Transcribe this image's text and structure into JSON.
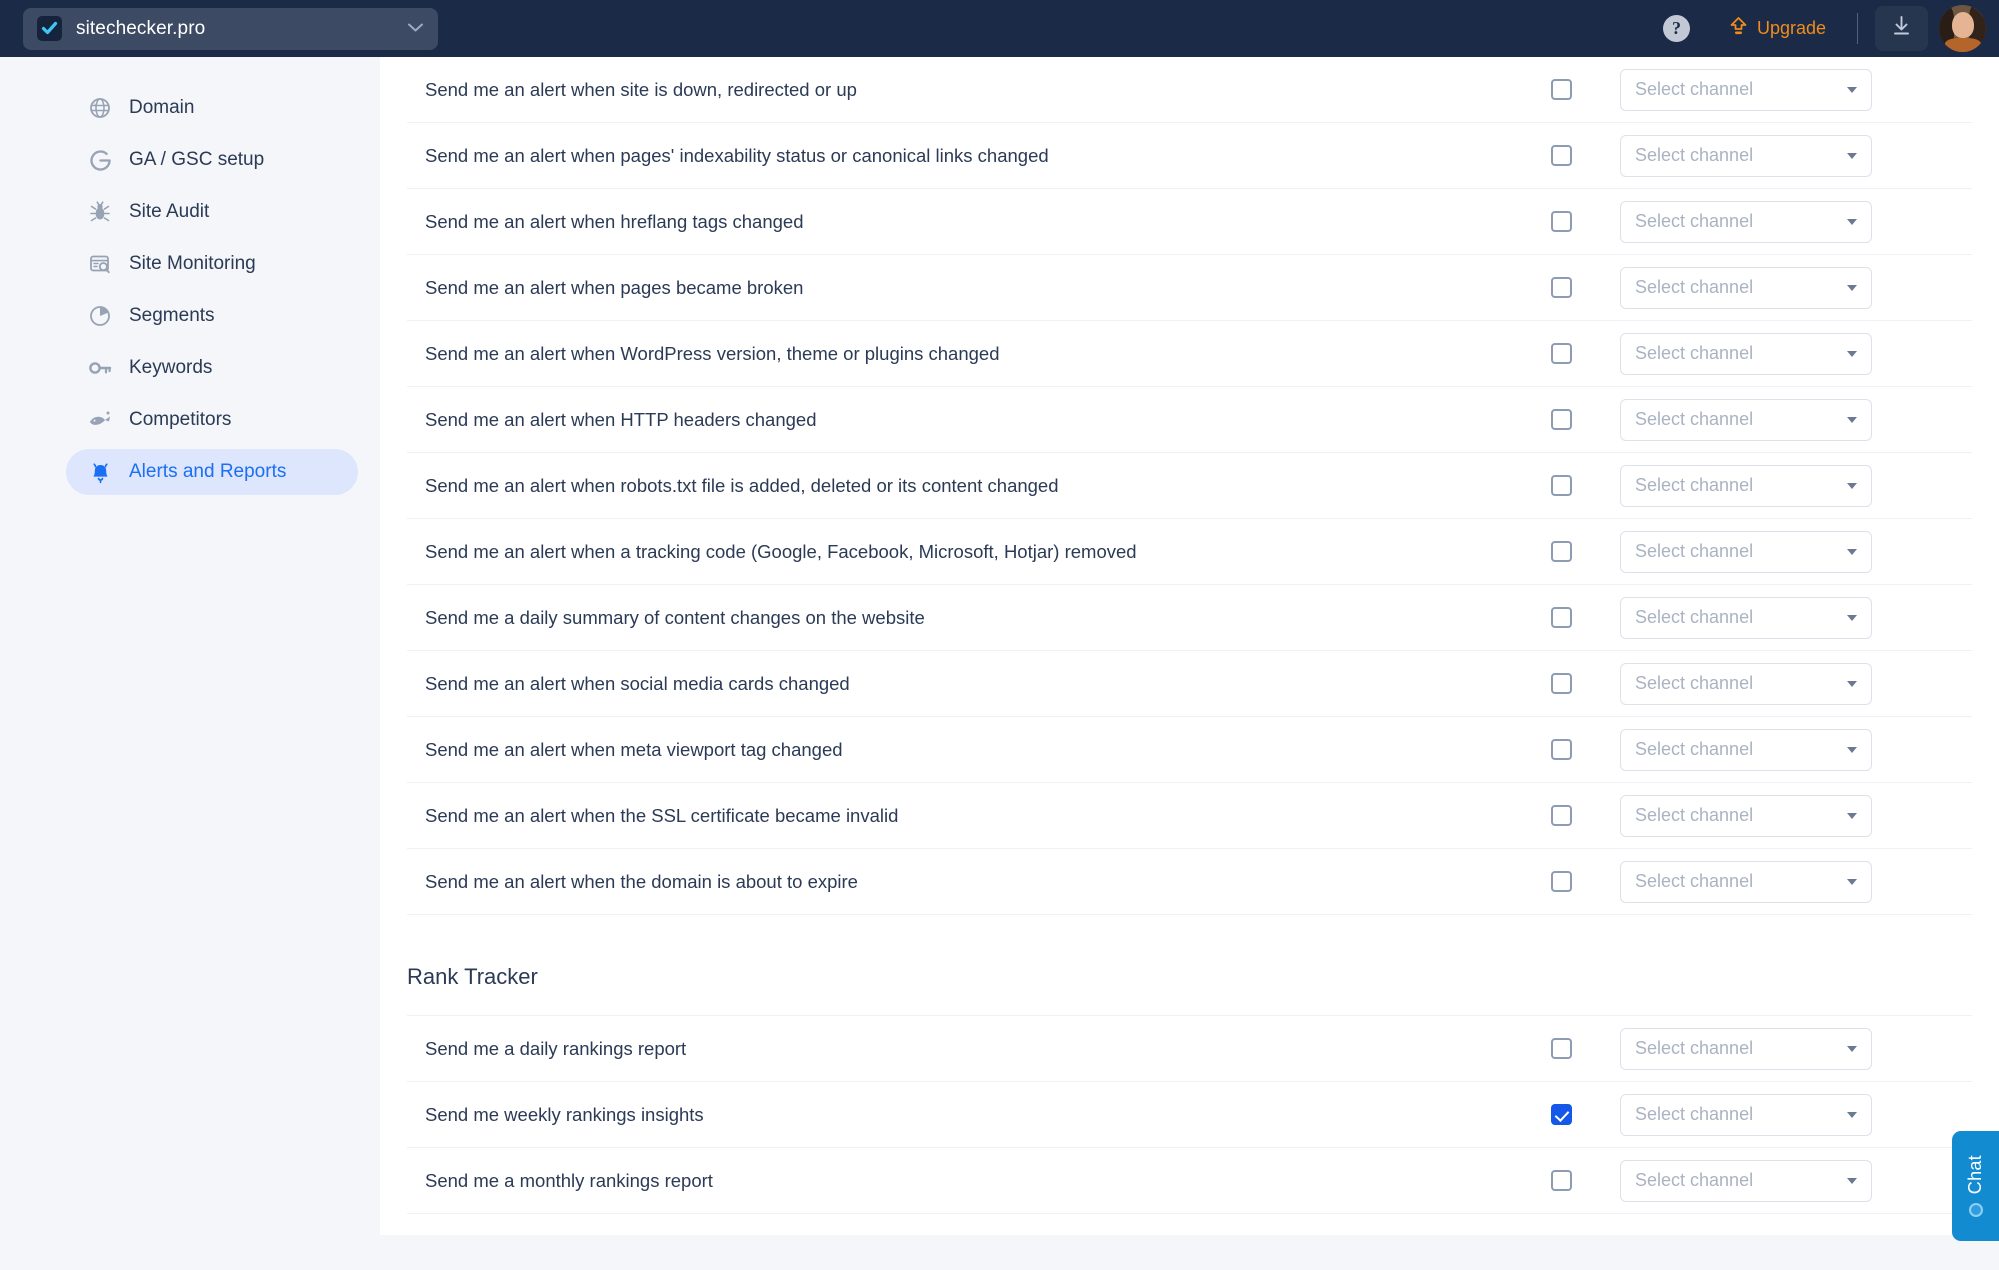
{
  "header": {
    "domain": "sitechecker.pro",
    "domain_chevron_icon": "chevron-down-icon",
    "favicon_icon": "checkmark-favicon",
    "help_label": "?",
    "upgrade_label": "Upgrade",
    "upgrade_icon": "upgrade-arrow-icon",
    "download_icon": "download-icon",
    "avatar_icon": "user-avatar"
  },
  "colors": {
    "topbar_bg": "#1b2a47",
    "accent_blue": "#1557e8",
    "sidebar_active_bg": "#dde6fc",
    "sidebar_active_text": "#1a6ff5",
    "upgrade_orange": "#f08c1b",
    "chat_blue": "#128bd1",
    "page_bg": "#f4f6f9",
    "panel_bg": "#ffffff"
  },
  "sidebar": {
    "items": [
      {
        "label": "Domain",
        "icon": "globe-icon",
        "active": false
      },
      {
        "label": "GA / GSC setup",
        "icon": "google-g-icon",
        "active": false
      },
      {
        "label": "Site Audit",
        "icon": "bug-icon",
        "active": false
      },
      {
        "label": "Site Monitoring",
        "icon": "monitor-search-icon",
        "active": false
      },
      {
        "label": "Segments",
        "icon": "pie-chart-icon",
        "active": false
      },
      {
        "label": "Keywords",
        "icon": "key-icon",
        "active": false
      },
      {
        "label": "Competitors",
        "icon": "fish-icon",
        "active": false
      },
      {
        "label": "Alerts and Reports",
        "icon": "bell-icon",
        "active": true
      }
    ]
  },
  "main": {
    "select_placeholder": "Select channel",
    "alert_rows": [
      {
        "label": "Send me an alert when site is down, redirected or up",
        "checked": false
      },
      {
        "label": "Send me an alert when pages' indexability status or canonical links changed",
        "checked": false
      },
      {
        "label": "Send me an alert when hreflang tags changed",
        "checked": false
      },
      {
        "label": "Send me an alert when pages became broken",
        "checked": false
      },
      {
        "label": "Send me an alert when WordPress version, theme or plugins changed",
        "checked": false
      },
      {
        "label": "Send me an alert when HTTP headers changed",
        "checked": false
      },
      {
        "label": "Send me an alert when robots.txt file is added, deleted or its content changed",
        "checked": false
      },
      {
        "label": "Send me an alert when a tracking code (Google, Facebook, Microsoft, Hotjar) removed",
        "checked": false
      },
      {
        "label": "Send me a daily summary of content changes on the website",
        "checked": false
      },
      {
        "label": "Send me an alert when social media cards changed",
        "checked": false
      },
      {
        "label": "Send me an alert when meta viewport tag changed",
        "checked": false
      },
      {
        "label": "Send me an alert when the SSL certificate became invalid",
        "checked": false
      },
      {
        "label": "Send me an alert when the domain is about to expire",
        "checked": false
      }
    ],
    "rank_tracker": {
      "title": "Rank Tracker",
      "rows": [
        {
          "label": "Send me a daily rankings report",
          "checked": false
        },
        {
          "label": "Send me weekly rankings insights",
          "checked": true
        },
        {
          "label": "Send me a monthly rankings report",
          "checked": false
        }
      ]
    }
  },
  "chat": {
    "label": "Chat",
    "dot_icon": "status-dot-icon"
  }
}
